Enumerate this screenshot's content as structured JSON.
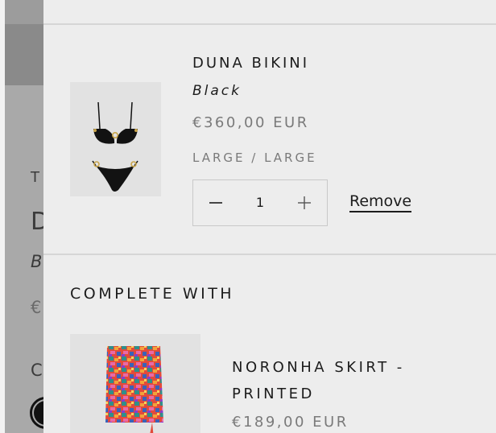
{
  "background_page": {
    "letter_t": "T",
    "letter_d": "D",
    "letter_b": "B",
    "letter_euro": "€",
    "letter_c": "C"
  },
  "cart_item": {
    "title": "DUNA BIKINI",
    "variant": "Black",
    "price": "€360,00 EUR",
    "size": "LARGE / LARGE",
    "quantity": "1",
    "remove_label": "Remove",
    "image_icon": "bikini-product-image"
  },
  "complete_with": {
    "heading": "COMPLETE WITH",
    "product": {
      "title": "NORONHA SKIRT - PRINTED",
      "price": "€189,00 EUR",
      "image_icon": "printed-skirt-product-image"
    }
  },
  "colors": {
    "drawer_bg": "#ededed",
    "overlay": "#a9a9a9",
    "text": "#1c1c1c",
    "muted_text": "#7a7a7a"
  }
}
